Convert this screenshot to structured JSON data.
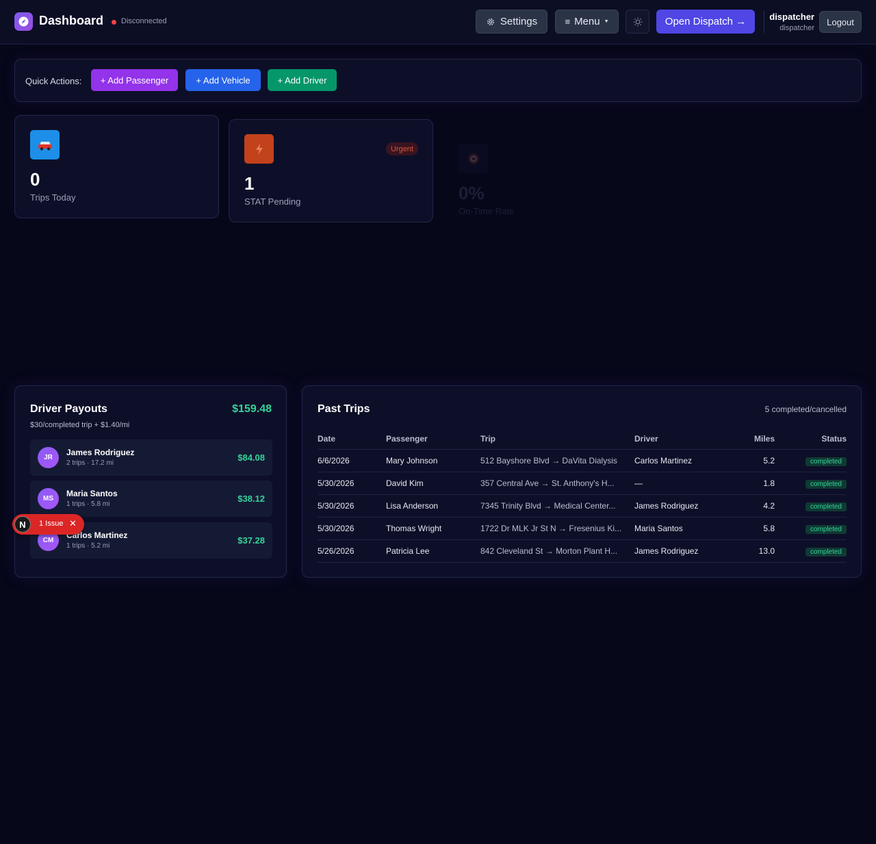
{
  "header": {
    "title": "Dashboard",
    "connection": "Disconnected",
    "settings_label": "Settings",
    "menu_label": "Menu",
    "dispatch_label": "Open Dispatch →",
    "user_name": "dispatcher",
    "user_role": "dispatcher",
    "logout_label": "Logout"
  },
  "quick_actions": {
    "label": "Quick Actions:",
    "buttons": [
      "+ Add Passenger",
      "+ Add Vehicle",
      "+ Add Driver"
    ]
  },
  "stats": [
    {
      "value": "0",
      "label": "Trips Today",
      "icon": "car-icon"
    },
    {
      "value": "1",
      "label": "STAT Pending",
      "badge": "Urgent",
      "icon": "lightning-icon"
    },
    {
      "value": "0%",
      "label": "On-Time Rate",
      "icon": "target-icon"
    }
  ],
  "payouts": {
    "title": "Driver Payouts",
    "total": "$159.48",
    "subtitle": "$30/completed trip + $1.40/mi",
    "drivers": [
      {
        "initials": "JR",
        "name": "James Rodriguez",
        "meta": "2 trips · 17.2 mi",
        "amount": "$84.08"
      },
      {
        "initials": "MS",
        "name": "Maria Santos",
        "meta": "1 trips · 5.8 mi",
        "amount": "$38.12"
      },
      {
        "initials": "CM",
        "name": "Carlos Martinez",
        "meta": "1 trips · 5.2 mi",
        "amount": "$37.28"
      }
    ]
  },
  "issue_badge": {
    "letter": "N",
    "text": "1 Issue"
  },
  "past_trips": {
    "title": "Past Trips",
    "count": "5 completed/cancelled",
    "columns": [
      "Date",
      "Passenger",
      "Trip",
      "Driver",
      "Miles",
      "Status"
    ],
    "rows": [
      {
        "date": "6/6/2026",
        "passenger": "Mary Johnson",
        "trip": "512 Bayshore Blvd → DaVita Dialysis",
        "driver": "Carlos Martinez",
        "miles": "5.2",
        "status": "completed"
      },
      {
        "date": "5/30/2026",
        "passenger": "David Kim",
        "trip": "357 Central Ave → St. Anthony's H...",
        "driver": "—",
        "miles": "1.8",
        "status": "completed"
      },
      {
        "date": "5/30/2026",
        "passenger": "Lisa Anderson",
        "trip": "7345 Trinity Blvd → Medical Center...",
        "driver": "James Rodriguez",
        "miles": "4.2",
        "status": "completed"
      },
      {
        "date": "5/30/2026",
        "passenger": "Thomas Wright",
        "trip": "1722 Dr MLK Jr St N → Fresenius Ki...",
        "driver": "Maria Santos",
        "miles": "5.8",
        "status": "completed"
      },
      {
        "date": "5/26/2026",
        "passenger": "Patricia Lee",
        "trip": "842 Cleveland St → Morton Plant H...",
        "driver": "James Rodriguez",
        "miles": "13.0",
        "status": "completed"
      }
    ]
  }
}
